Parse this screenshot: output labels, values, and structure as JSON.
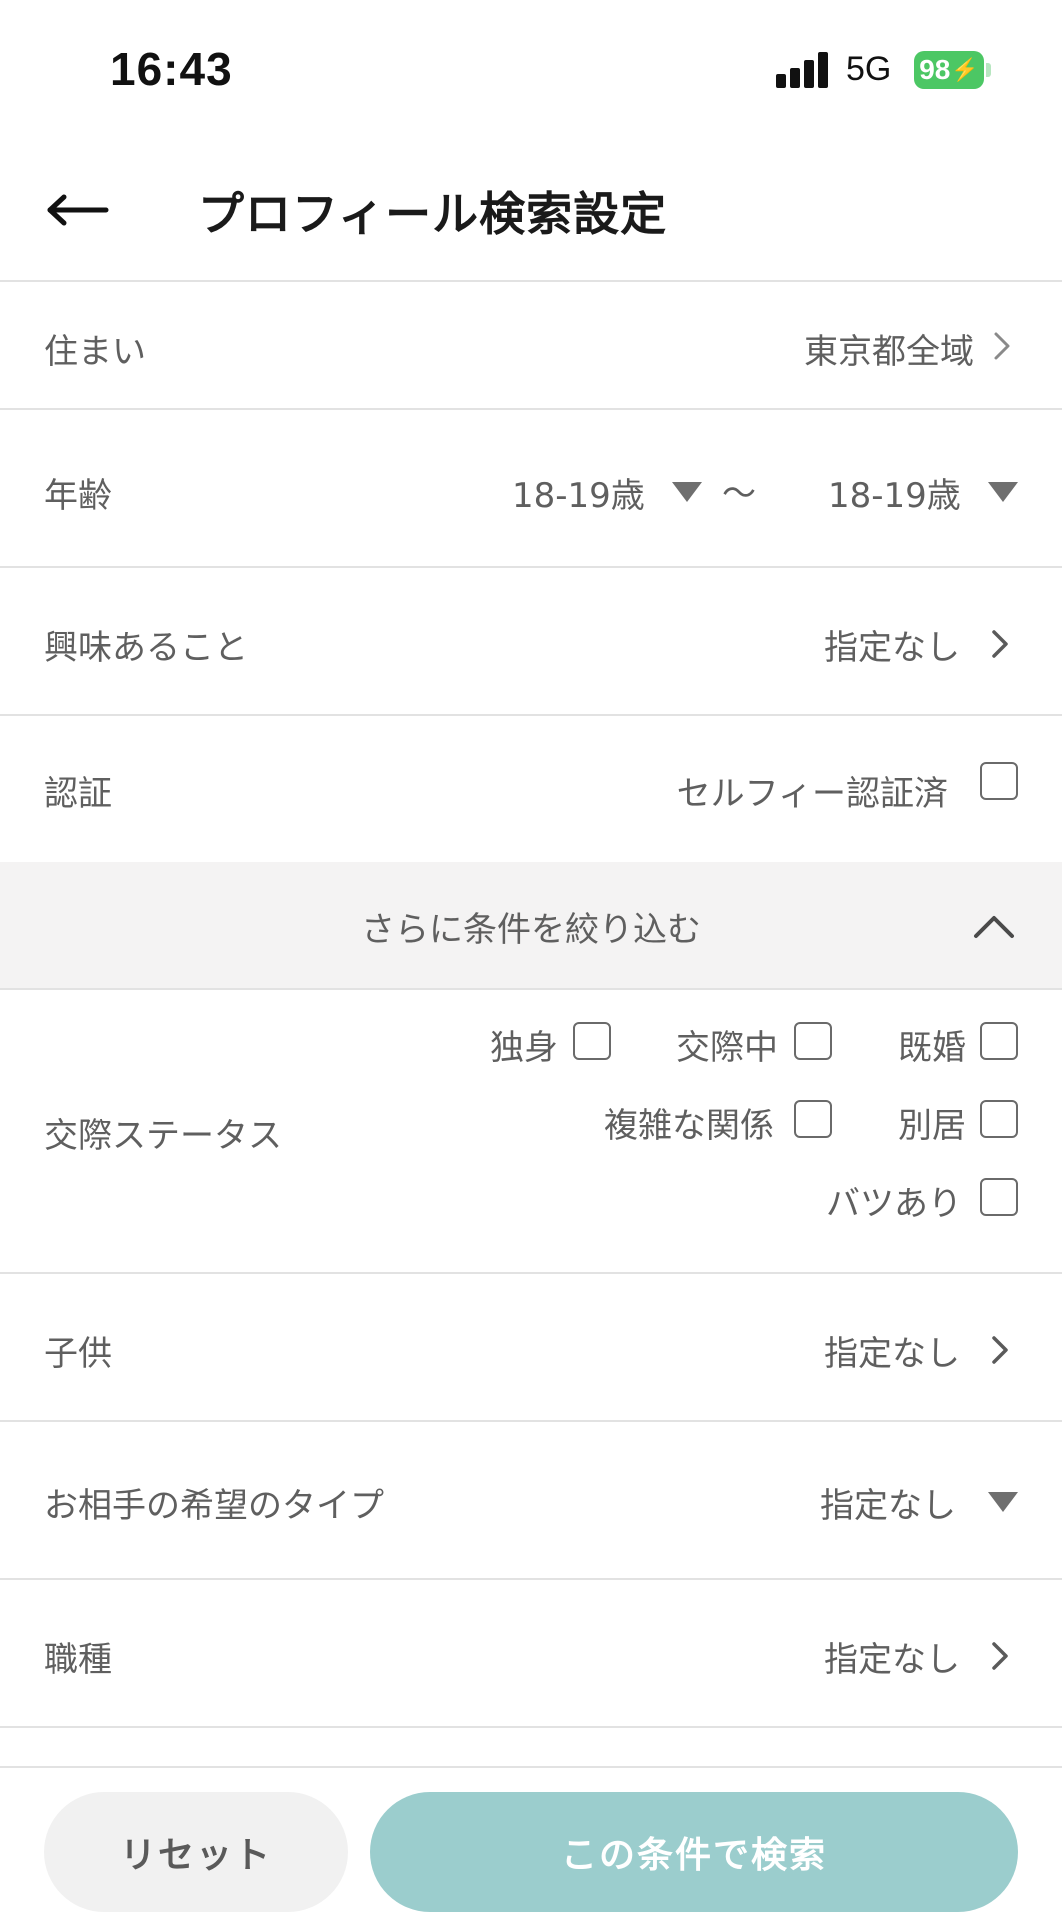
{
  "status_bar": {
    "time": "16:43",
    "network": "5G",
    "battery": "98"
  },
  "header": {
    "back_icon": "back-arrow-icon",
    "title": "プロフィール検索設定"
  },
  "filters": {
    "residence": {
      "label": "住まい",
      "value": "東京都全域"
    },
    "age": {
      "label": "年齢",
      "min": "18-19歳",
      "separator": "〜",
      "max": "18-19歳"
    },
    "interests": {
      "label": "興味あること",
      "value": "指定なし"
    },
    "verification": {
      "label": "認証",
      "option": "セルフィー認証済",
      "checked": false
    },
    "more_toggle": {
      "label": "さらに条件を絞り込む",
      "expanded": true
    },
    "relationship_status": {
      "label": "交際ステータス",
      "options": [
        {
          "label": "独身",
          "checked": false
        },
        {
          "label": "交際中",
          "checked": false
        },
        {
          "label": "既婚",
          "checked": false
        },
        {
          "label": "複雑な関係",
          "checked": false
        },
        {
          "label": "別居",
          "checked": false
        },
        {
          "label": "バツあり",
          "checked": false
        }
      ]
    },
    "children": {
      "label": "子供",
      "value": "指定なし"
    },
    "partner_type": {
      "label": "お相手の希望のタイプ",
      "value": "指定なし"
    },
    "occupation": {
      "label": "職種",
      "value": "指定なし"
    }
  },
  "footer": {
    "reset_label": "リセット",
    "search_label": "この条件で検索"
  },
  "colors": {
    "accent": "#9bcdcd",
    "battery": "#4cc764",
    "divider": "#e2e2e2",
    "section_band": "#f4f3f3"
  }
}
